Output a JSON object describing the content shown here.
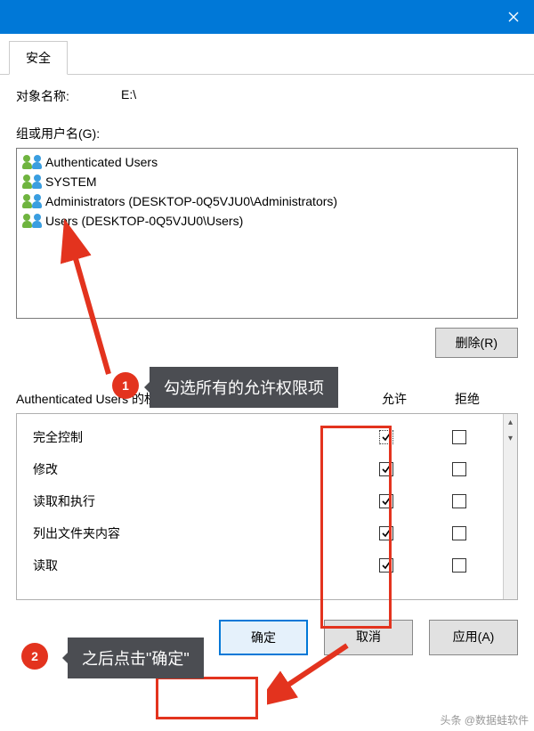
{
  "titlebar": {
    "close": "✕"
  },
  "tab": {
    "security": "安全"
  },
  "object": {
    "label": "对象名称:",
    "value": "E:\\"
  },
  "groups": {
    "label": "组或用户名(G):",
    "items": [
      {
        "name": "Authenticated Users"
      },
      {
        "name": "SYSTEM"
      },
      {
        "name": "Administrators (DESKTOP-0Q5VJU0\\Administrators)"
      },
      {
        "name": "Users (DESKTOP-0Q5VJU0\\Users)"
      }
    ]
  },
  "buttons": {
    "remove": "删除(R)",
    "ok": "确定",
    "cancel": "取消",
    "apply": "应用(A)"
  },
  "perm": {
    "header": "Authenticated Users 的权限(P)",
    "allow": "允许",
    "deny": "拒绝",
    "rows": [
      {
        "name": "完全控制",
        "allow": true,
        "deny": false,
        "dotted": true
      },
      {
        "name": "修改",
        "allow": true,
        "deny": false
      },
      {
        "name": "读取和执行",
        "allow": true,
        "deny": false
      },
      {
        "name": "列出文件夹内容",
        "allow": true,
        "deny": false
      },
      {
        "name": "读取",
        "allow": true,
        "deny": false
      }
    ]
  },
  "callouts": {
    "c1": "勾选所有的允许权限项",
    "c2": "之后点击\"确定\""
  },
  "badges": {
    "b1": "1",
    "b2": "2"
  },
  "watermark": "头条 @数据蛙软件"
}
